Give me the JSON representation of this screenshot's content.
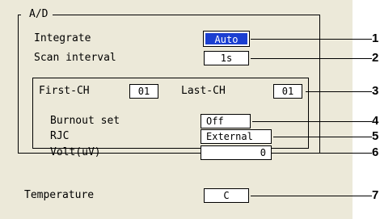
{
  "group": {
    "title": "A/D"
  },
  "integrate": {
    "label": "Integrate",
    "value": "Auto"
  },
  "scan_interval": {
    "label": "Scan interval",
    "value": "1s"
  },
  "first_ch": {
    "label": "First-CH",
    "value": "01"
  },
  "last_ch": {
    "label": "Last-CH",
    "value": "01"
  },
  "burnout": {
    "label": "Burnout set",
    "value": "Off"
  },
  "rjc": {
    "label": "RJC",
    "value": "External"
  },
  "volt": {
    "label": "Volt(uV)",
    "value": "0"
  },
  "temperature": {
    "label": "Temperature",
    "value": "C"
  },
  "callouts": [
    "1",
    "2",
    "3",
    "4",
    "5",
    "6",
    "7"
  ]
}
